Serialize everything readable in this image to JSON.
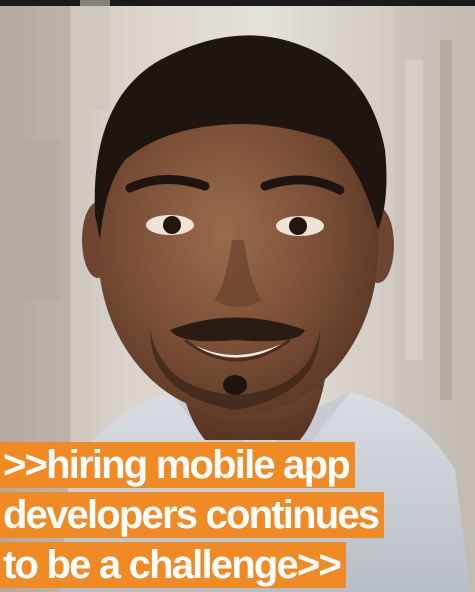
{
  "caption": {
    "lines": [
      ">>hiring mobile app",
      "developers continues",
      "to be a challenge>>"
    ]
  },
  "colors": {
    "caption_background": "#f08a24",
    "caption_text": "#ffffff"
  }
}
